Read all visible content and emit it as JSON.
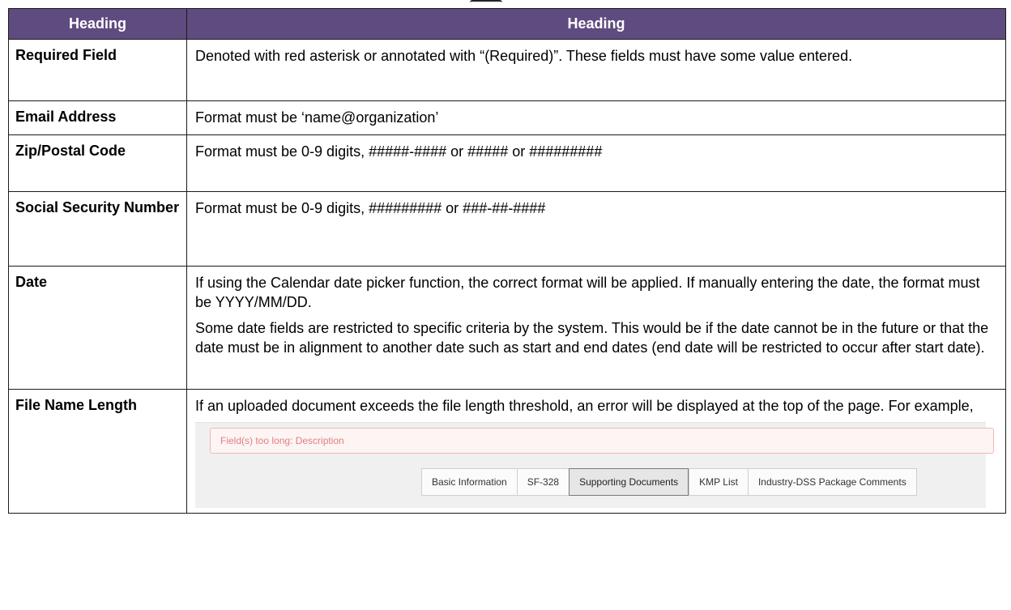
{
  "table": {
    "headers": [
      "Heading",
      "Heading"
    ],
    "rows": [
      {
        "name": "Required Field",
        "desc": [
          "Denoted with red asterisk or annotated with “(Required)”. These fields must have some value entered."
        ]
      },
      {
        "name": "Email Address",
        "desc": [
          "Format must be ‘name@organization’"
        ]
      },
      {
        "name": "Zip/Postal Code",
        "desc": [
          "Format must be 0-9 digits, #####-#### or ##### or #########"
        ]
      },
      {
        "name": "Social Security Number",
        "desc": [
          "Format must be 0-9 digits, ######### or ###-##-####"
        ]
      },
      {
        "name": "Date",
        "desc": [
          "If using the Calendar date picker function, the correct format will be applied. If manually entering the date, the format must be YYYY/MM/DD.",
          "Some date fields are restricted to specific criteria by the system. This would be if the date cannot be in the future or that the date must be in alignment to another date such as start and end dates (end date will be restricted to occur after start date)."
        ]
      },
      {
        "name": "File Name Length",
        "desc": [
          "If an uploaded document exceeds the file length threshold, an error will be displayed at the top of the page. For example,"
        ]
      }
    ]
  },
  "example_screenshot": {
    "error_text": "Field(s) too long: Description",
    "tabs": [
      "Basic Information",
      "SF-328",
      "Supporting Documents",
      "KMP List",
      "Industry-DSS Package Comments"
    ],
    "active_tab": "Supporting Documents"
  },
  "colors": {
    "header_bg": "#5f4b7f",
    "header_text": "#ffffff",
    "error_text": "#e08080",
    "error_border": "#f0b9b9"
  }
}
